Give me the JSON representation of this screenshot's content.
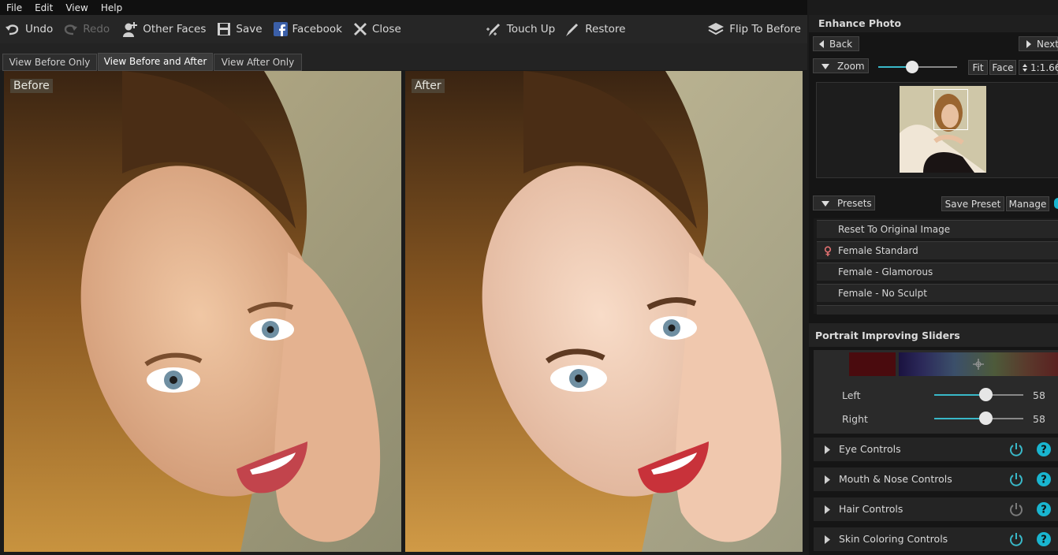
{
  "menu": [
    "File",
    "Edit",
    "View",
    "Help"
  ],
  "toolbar": {
    "undo": "Undo",
    "redo": "Redo",
    "other_faces": "Other Faces",
    "save": "Save",
    "facebook": "Facebook",
    "close": "Close",
    "touch_up": "Touch Up",
    "restore": "Restore",
    "flip": "Flip To Before"
  },
  "view_tabs": [
    "View Before Only",
    "View Before and After",
    "View After Only"
  ],
  "panes": {
    "before": "Before",
    "after": "After"
  },
  "right_panel": {
    "title": "Enhance Photo",
    "back": "Back",
    "next": "Next",
    "zoom": {
      "label": "Zoom",
      "fit": "Fit",
      "face": "Face",
      "value": "1:1.66"
    },
    "presets": {
      "label": "Presets",
      "save": "Save Preset",
      "manage": "Manage",
      "items": [
        "Reset To Original Image",
        "Female Standard",
        "Female - Glamorous",
        "Female - No Sculpt"
      ]
    },
    "sliders": {
      "title": "Portrait Improving Sliders",
      "left_label": "Left",
      "left_value": "58",
      "right_label": "Right",
      "right_value": "58"
    },
    "controls": [
      "Eye Controls",
      "Mouth & Nose Controls",
      "Hair Controls",
      "Skin Coloring Controls"
    ]
  },
  "colors": {
    "accent": "#39b8c8",
    "swatch": "#4a0b0e",
    "help": "#19b5d0"
  }
}
